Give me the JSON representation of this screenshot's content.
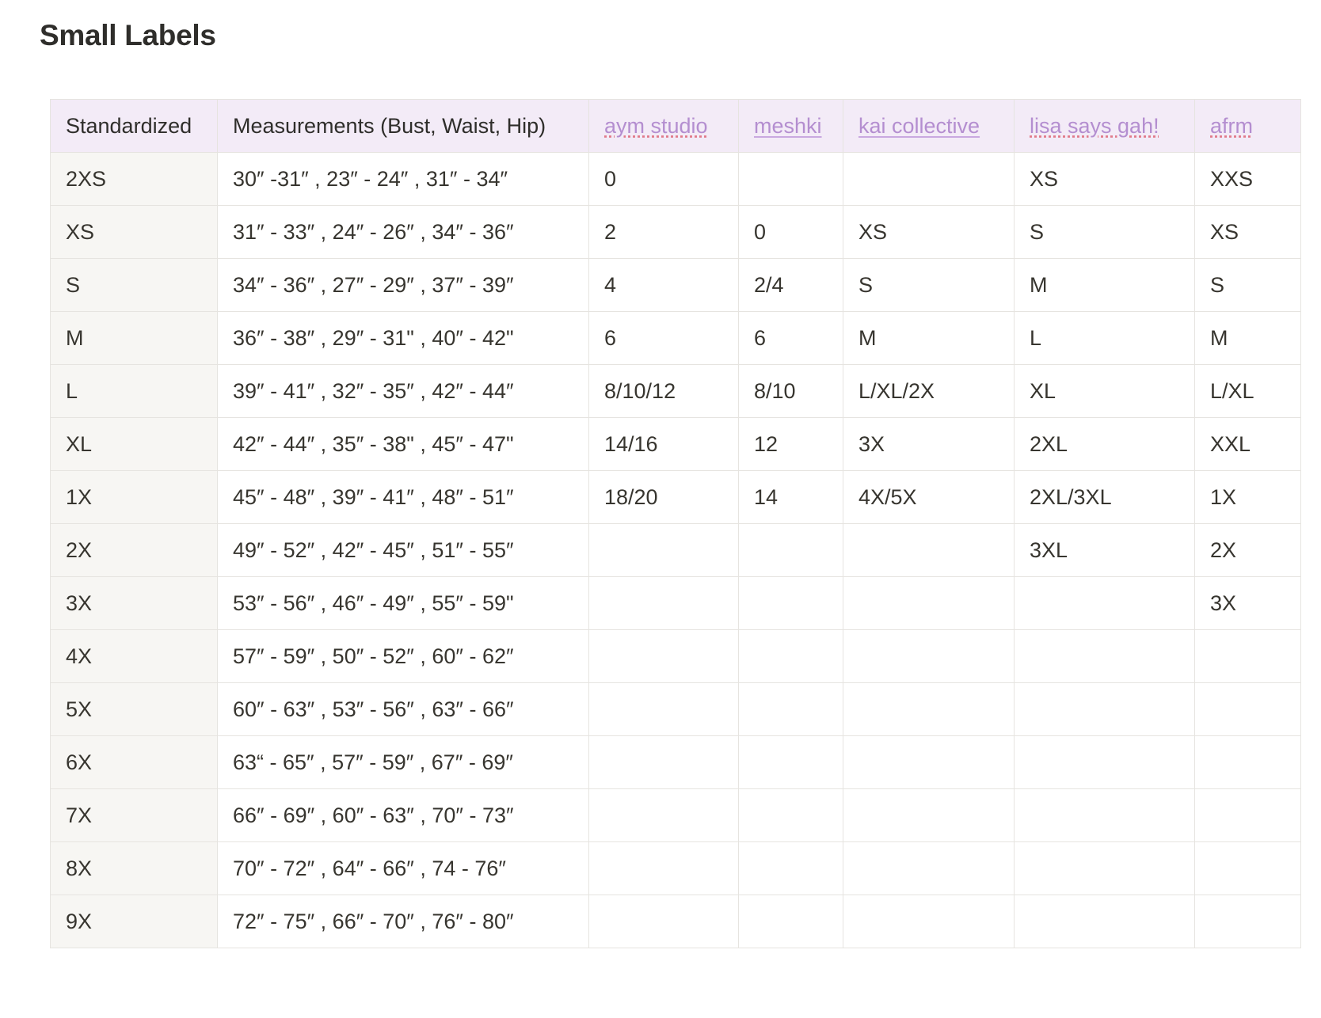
{
  "page": {
    "title": "Small Labels"
  },
  "table": {
    "headers": [
      "Standardized",
      "Measurements (Bust, Waist, Hip)",
      "aym studio",
      "meshki",
      "kai collective",
      "lisa says gah!",
      "afrm"
    ],
    "rows": [
      [
        "2XS",
        "30″ -31″ , 23″ - 24″ , 31″ - 34″",
        "0",
        "",
        "",
        "XS",
        "XXS"
      ],
      [
        "XS",
        "31″ - 33″ , 24″ - 26″ , 34″ - 36″",
        "2",
        "0",
        "XS",
        "S",
        "XS"
      ],
      [
        "S",
        "34″ - 36″ , 27″ - 29″ , 37″ - 39″",
        "4",
        "2/4",
        "S",
        "M",
        "S"
      ],
      [
        "M",
        "36″ - 38″ , 29″ - 31\" , 40″ - 42\"",
        "6",
        "6",
        "M",
        "L",
        "M"
      ],
      [
        "L",
        "39″ - 41″ , 32″ - 35″ , 42″ - 44″",
        "8/10/12",
        "8/10",
        "L/XL/2X",
        "XL",
        "L/XL"
      ],
      [
        "XL",
        "42″ - 44″ , 35″ - 38\" ,  45″ - 47\"",
        "14/16",
        "12",
        "3X",
        "2XL",
        "XXL"
      ],
      [
        "1X",
        "45″ - 48″ , 39″ - 41″ , 48″ - 51″",
        "18/20",
        "14",
        "4X/5X",
        "2XL/3XL",
        "1X"
      ],
      [
        "2X",
        "49″ - 52″ , 42″ - 45″ , 51″ - 55″",
        "",
        "",
        "",
        "3XL",
        "2X"
      ],
      [
        "3X",
        "53″ - 56″ , 46″ - 49″ , 55″ - 59\"",
        "",
        "",
        "",
        "",
        "3X"
      ],
      [
        "4X",
        "57″ - 59″ , 50″ - 52″ , 60″ - 62″",
        "",
        "",
        "",
        "",
        ""
      ],
      [
        "5X",
        "60″ - 63″ , 53″ - 56″ , 63″ - 66″",
        "",
        "",
        "",
        "",
        ""
      ],
      [
        "6X",
        "63“ - 65″ , 57″ - 59″ , 67″ - 69″",
        "",
        "",
        "",
        "",
        ""
      ],
      [
        "7X",
        "66″ - 69″ , 60″ - 63″ , 70″ - 73″",
        "",
        "",
        "",
        "",
        ""
      ],
      [
        "8X",
        "70″ - 72″ , 64″ - 66″ , 74 - 76″",
        "",
        "",
        "",
        "",
        ""
      ],
      [
        "9X",
        "72″ - 75″ , 66″ - 70″ , 76″ - 80″",
        "",
        "",
        "",
        "",
        ""
      ]
    ]
  },
  "colors": {
    "header_bg": "#f3ebf7",
    "first_col_bg": "#f7f6f3",
    "link": "#b48ed0",
    "border": "#e6e4e0"
  }
}
